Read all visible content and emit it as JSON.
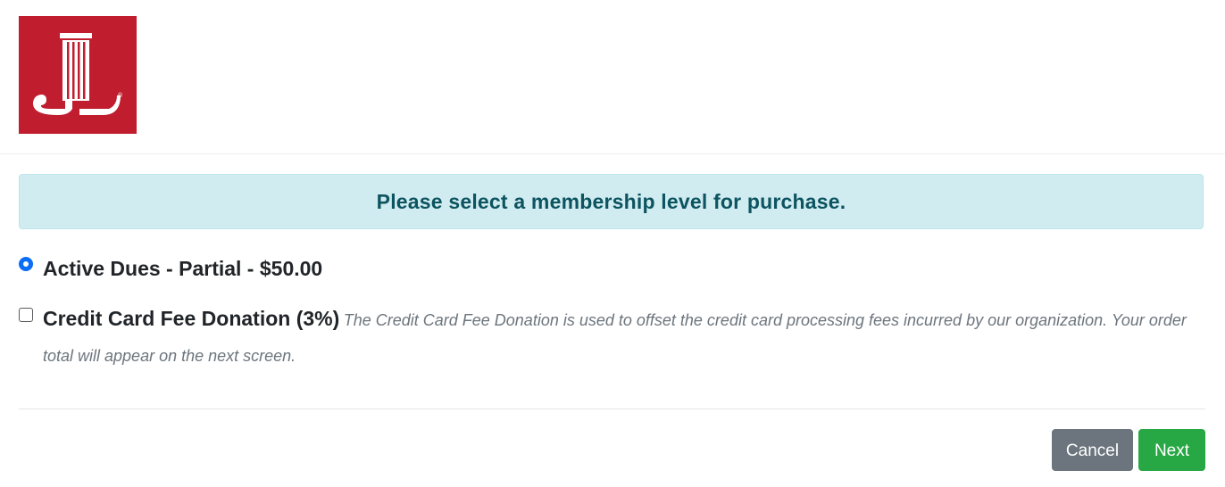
{
  "logo": {
    "icon": "jl-column-logo-icon",
    "mark": "®",
    "color": "#c01d2f"
  },
  "alert": {
    "message": "Please select a membership level for purchase."
  },
  "options": [
    {
      "label": "Active Dues - Partial - $50.00",
      "type": "radio",
      "checked": true,
      "description": ""
    },
    {
      "label": "Credit Card Fee Donation (3%)",
      "type": "checkbox",
      "checked": false,
      "description": "The Credit Card Fee Donation is used to offset the credit card processing fees incurred by our organization. Your order total will appear on the next screen."
    }
  ],
  "buttons": {
    "cancel_label": "Cancel",
    "next_label": "Next"
  },
  "colors": {
    "alert_bg": "#d1ecf1",
    "alert_text": "#0c5460",
    "cancel_bg": "#6c757d",
    "next_bg": "#28a745",
    "radio_accent": "#0b6ef6"
  }
}
